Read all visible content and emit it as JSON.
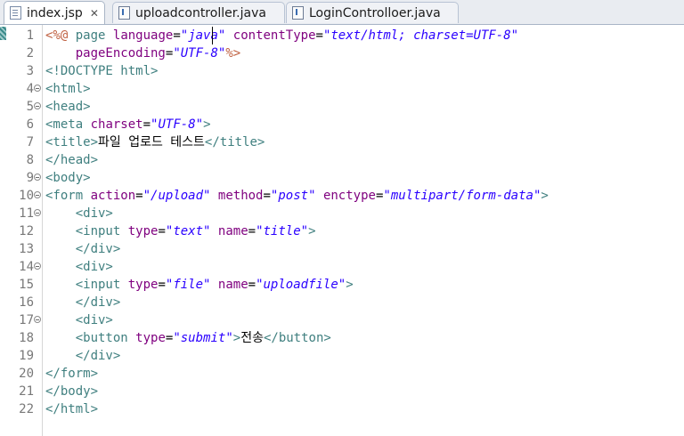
{
  "tabs": [
    {
      "label": "index.jsp",
      "close": "✕",
      "icon": "jsp-file-icon",
      "active": true
    },
    {
      "label": "uploadcontroller.java",
      "icon": "java-file-icon",
      "active": false
    },
    {
      "label": "LoginControlloer.java",
      "icon": "java-file-icon",
      "active": false
    }
  ],
  "lines": [
    {
      "num": "1",
      "fold": false,
      "tokens": [
        {
          "t": "dir",
          "v": "<%@"
        },
        {
          "t": "plain",
          "v": " "
        },
        {
          "t": "tag",
          "v": "page"
        },
        {
          "t": "plain",
          "v": " "
        },
        {
          "t": "attr",
          "v": "language"
        },
        {
          "t": "plain",
          "v": "="
        },
        {
          "t": "val",
          "v": "\"java\""
        },
        {
          "t": "plain",
          "v": " "
        },
        {
          "t": "attr",
          "v": "contentType"
        },
        {
          "t": "plain",
          "v": "="
        },
        {
          "t": "val",
          "v": "\"text/html; charset=UTF-8\""
        }
      ]
    },
    {
      "num": "2",
      "fold": false,
      "tokens": [
        {
          "t": "plain",
          "v": "    "
        },
        {
          "t": "attr",
          "v": "pageEncoding"
        },
        {
          "t": "plain",
          "v": "="
        },
        {
          "t": "val",
          "v": "\"UTF-8\""
        },
        {
          "t": "dir",
          "v": "%>"
        }
      ]
    },
    {
      "num": "3",
      "fold": false,
      "tokens": [
        {
          "t": "tag",
          "v": "<!DOCTYPE"
        },
        {
          "t": "plain",
          "v": " "
        },
        {
          "t": "tag",
          "v": "html"
        },
        {
          "t": "tag",
          "v": ">"
        }
      ]
    },
    {
      "num": "4",
      "fold": true,
      "tokens": [
        {
          "t": "tag",
          "v": "<html>"
        }
      ]
    },
    {
      "num": "5",
      "fold": true,
      "tokens": [
        {
          "t": "tag",
          "v": "<head>"
        }
      ]
    },
    {
      "num": "6",
      "fold": false,
      "tokens": [
        {
          "t": "tag",
          "v": "<meta"
        },
        {
          "t": "plain",
          "v": " "
        },
        {
          "t": "attr",
          "v": "charset"
        },
        {
          "t": "plain",
          "v": "="
        },
        {
          "t": "val",
          "v": "\"UTF-8\""
        },
        {
          "t": "tag",
          "v": ">"
        }
      ]
    },
    {
      "num": "7",
      "fold": false,
      "tokens": [
        {
          "t": "tag",
          "v": "<title>"
        },
        {
          "t": "plain",
          "v": "파일 업로드 테스트"
        },
        {
          "t": "tag",
          "v": "</title>"
        }
      ]
    },
    {
      "num": "8",
      "fold": false,
      "tokens": [
        {
          "t": "tag",
          "v": "</head>"
        }
      ]
    },
    {
      "num": "9",
      "fold": true,
      "tokens": [
        {
          "t": "tag",
          "v": "<body>"
        }
      ]
    },
    {
      "num": "10",
      "fold": true,
      "tokens": [
        {
          "t": "tag",
          "v": "<form"
        },
        {
          "t": "plain",
          "v": " "
        },
        {
          "t": "attr",
          "v": "action"
        },
        {
          "t": "plain",
          "v": "="
        },
        {
          "t": "val",
          "v": "\"/upload\""
        },
        {
          "t": "plain",
          "v": " "
        },
        {
          "t": "attr",
          "v": "method"
        },
        {
          "t": "plain",
          "v": "="
        },
        {
          "t": "val",
          "v": "\"post\""
        },
        {
          "t": "plain",
          "v": " "
        },
        {
          "t": "attr",
          "v": "enctype"
        },
        {
          "t": "plain",
          "v": "="
        },
        {
          "t": "val",
          "v": "\"multipart/form-data\""
        },
        {
          "t": "tag",
          "v": ">"
        }
      ]
    },
    {
      "num": "11",
      "fold": true,
      "tokens": [
        {
          "t": "plain",
          "v": "    "
        },
        {
          "t": "tag",
          "v": "<div>"
        }
      ]
    },
    {
      "num": "12",
      "fold": false,
      "tokens": [
        {
          "t": "plain",
          "v": "    "
        },
        {
          "t": "tag",
          "v": "<input"
        },
        {
          "t": "plain",
          "v": " "
        },
        {
          "t": "attr",
          "v": "type"
        },
        {
          "t": "plain",
          "v": "="
        },
        {
          "t": "val",
          "v": "\"text\""
        },
        {
          "t": "plain",
          "v": " "
        },
        {
          "t": "attr",
          "v": "name"
        },
        {
          "t": "plain",
          "v": "="
        },
        {
          "t": "val",
          "v": "\"title\""
        },
        {
          "t": "tag",
          "v": ">"
        }
      ]
    },
    {
      "num": "13",
      "fold": false,
      "tokens": [
        {
          "t": "plain",
          "v": "    "
        },
        {
          "t": "tag",
          "v": "</div>"
        }
      ]
    },
    {
      "num": "14",
      "fold": true,
      "tokens": [
        {
          "t": "plain",
          "v": "    "
        },
        {
          "t": "tag",
          "v": "<div>"
        }
      ]
    },
    {
      "num": "15",
      "fold": false,
      "tokens": [
        {
          "t": "plain",
          "v": "    "
        },
        {
          "t": "tag",
          "v": "<input"
        },
        {
          "t": "plain",
          "v": " "
        },
        {
          "t": "attr",
          "v": "type"
        },
        {
          "t": "plain",
          "v": "="
        },
        {
          "t": "val",
          "v": "\"file\""
        },
        {
          "t": "plain",
          "v": " "
        },
        {
          "t": "attr",
          "v": "name"
        },
        {
          "t": "plain",
          "v": "="
        },
        {
          "t": "val",
          "v": "\"uploadfile\""
        },
        {
          "t": "tag",
          "v": ">"
        }
      ]
    },
    {
      "num": "16",
      "fold": false,
      "tokens": [
        {
          "t": "plain",
          "v": "    "
        },
        {
          "t": "tag",
          "v": "</div>"
        }
      ]
    },
    {
      "num": "17",
      "fold": true,
      "tokens": [
        {
          "t": "plain",
          "v": "    "
        },
        {
          "t": "tag",
          "v": "<div>"
        }
      ]
    },
    {
      "num": "18",
      "fold": false,
      "tokens": [
        {
          "t": "plain",
          "v": "    "
        },
        {
          "t": "tag",
          "v": "<button"
        },
        {
          "t": "plain",
          "v": " "
        },
        {
          "t": "attr",
          "v": "type"
        },
        {
          "t": "plain",
          "v": "="
        },
        {
          "t": "val",
          "v": "\"submit\""
        },
        {
          "t": "tag",
          "v": ">"
        },
        {
          "t": "plain",
          "v": "전송"
        },
        {
          "t": "tag",
          "v": "</button>"
        }
      ]
    },
    {
      "num": "19",
      "fold": false,
      "tokens": [
        {
          "t": "plain",
          "v": "    "
        },
        {
          "t": "tag",
          "v": "</div>"
        }
      ]
    },
    {
      "num": "20",
      "fold": false,
      "tokens": [
        {
          "t": "tag",
          "v": "</form>"
        }
      ]
    },
    {
      "num": "21",
      "fold": false,
      "tokens": [
        {
          "t": "tag",
          "v": "</body>"
        }
      ]
    },
    {
      "num": "22",
      "fold": false,
      "tokens": [
        {
          "t": "tag",
          "v": "</html>"
        }
      ]
    }
  ]
}
